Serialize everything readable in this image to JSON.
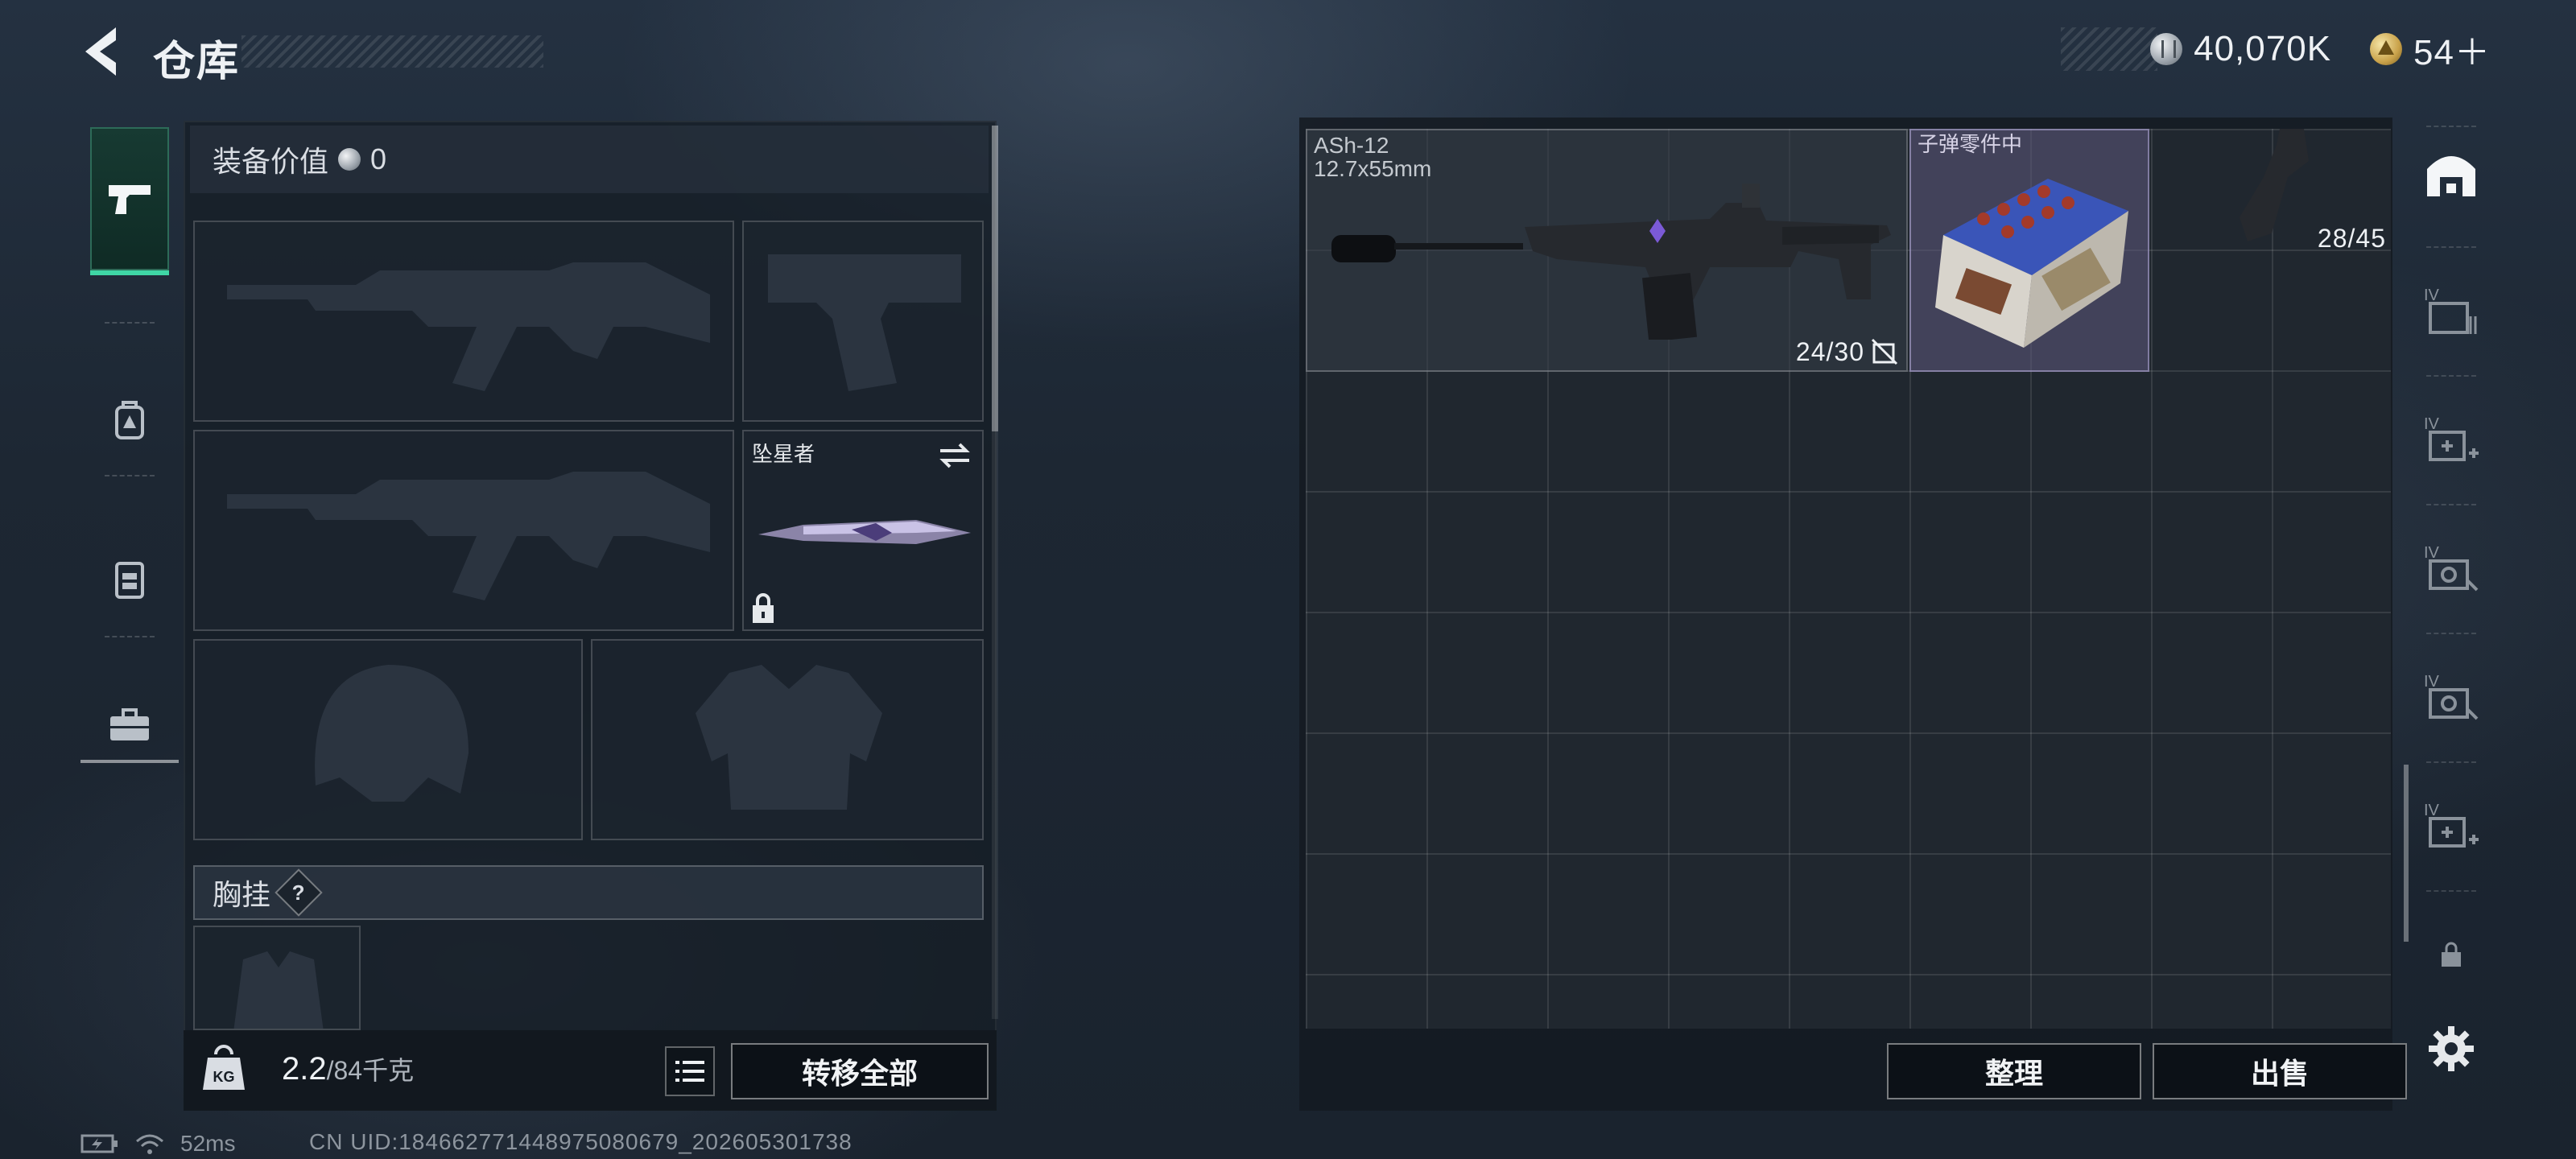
{
  "header": {
    "title": "仓库",
    "currencies": [
      {
        "icon": "silver-coin-icon",
        "value": "40,070K"
      },
      {
        "icon": "gold-coin-icon",
        "value": "54＋"
      }
    ]
  },
  "left_nav": {
    "items": [
      {
        "icon": "pistol-icon",
        "active": true
      },
      {
        "icon": "backpack-icon",
        "active": false
      },
      {
        "icon": "vest-icon",
        "active": false
      },
      {
        "icon": "toolbox-icon",
        "active": false
      }
    ]
  },
  "equipment": {
    "value_label": "装备价值",
    "value": "0",
    "melee_name": "坠星者",
    "chest_rig_label": "胸挂",
    "help_mark": "?",
    "weight_current": "2.2",
    "weight_max": "/84千克",
    "weight_icon_label": "KG",
    "transfer_all_label": "转移全部"
  },
  "storage": {
    "items": [
      {
        "name": "ASh-12",
        "caliber": "12.7x55mm",
        "count": "24/30"
      },
      {
        "name": "子弹零件中",
        "kind": "ammo-parts-crate"
      },
      {
        "name": "",
        "count": "28/45"
      }
    ],
    "sort_label": "整理",
    "sell_label": "出售"
  },
  "right_rail": {
    "items": [
      {
        "icon": "storage-home-icon",
        "tier": ""
      },
      {
        "icon": "storage-tab-icon",
        "tier": "IV"
      },
      {
        "icon": "storage-add-icon",
        "tier": "IV"
      },
      {
        "icon": "storage-tab-icon",
        "tier": "IV"
      },
      {
        "icon": "storage-tab-icon",
        "tier": "IV"
      },
      {
        "icon": "storage-add-icon",
        "tier": "IV"
      },
      {
        "icon": "lock-icon",
        "tier": ""
      },
      {
        "icon": "gear-icon",
        "tier": ""
      }
    ]
  },
  "status_bar": {
    "ping": "52ms",
    "uid": "CN UID:18466277144897508067​9_202605301738"
  },
  "colors": {
    "accent": "#3fd6a5",
    "panel": "#161d25",
    "ammo_tile": "#5f5a7d"
  }
}
